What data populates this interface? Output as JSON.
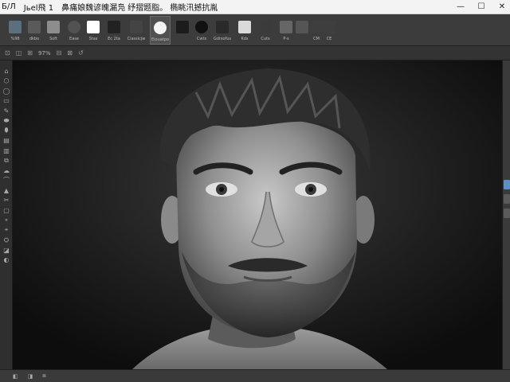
{
  "window": {
    "title_app": "Б/Л",
    "title_doc": "Jьel飛 1",
    "title_text": "鼻痛娘魏谚魄漏凫 纾摺题脂。 椭眺汛撼抗胤",
    "controls": [
      "—",
      "☐",
      "✕"
    ]
  },
  "presets": [
    {
      "label": "%98",
      "color": "#5b6f7e",
      "icon": "pointer-icon"
    },
    {
      "label": "dkbo",
      "color": "#5a5a5a",
      "icon": "brush-icon"
    },
    {
      "label": "Soft",
      "color": "#8d8d8d",
      "icon": "soft-brush-icon"
    },
    {
      "label": "Ease",
      "color": "#525252",
      "icon": "round-brush-icon"
    },
    {
      "label": "Stas",
      "color": "#ffffff",
      "icon": "square-brush-icon"
    },
    {
      "label": "Ec 2ta",
      "color": "#222222",
      "icon": "half-brush-icon"
    },
    {
      "label": "Ciassicjw",
      "color": "#444444",
      "icon": "gradient-brush-icon"
    },
    {
      "label": "Eiouatpo",
      "color": "#f4f4f4",
      "icon": "circle-brush-icon"
    },
    {
      "label": "",
      "color": "#1c1c1c",
      "icon": "ink-brush-icon"
    },
    {
      "label": "Cwts",
      "color": "#111111",
      "icon": "black-circle-icon"
    },
    {
      "label": "Gdrsofus",
      "color": "#2a2a2a",
      "icon": "splat-brush-icon"
    },
    {
      "label": "Kds",
      "color": "#dadada",
      "icon": "eraser-brush-icon"
    },
    {
      "label": "Cuts",
      "color": "#3b3b3b",
      "icon": "chalk-brush-icon"
    },
    {
      "label": "P-s",
      "color": "#666666",
      "icon": "pen-icon"
    },
    {
      "label": "",
      "color": "#555555",
      "icon": "tool-a-icon"
    },
    {
      "label": "CM",
      "color": "#3e3e3e",
      "icon": "tool-b-icon"
    },
    {
      "label": "CE",
      "color": "#3e3e3e",
      "icon": "tool-c-icon"
    }
  ],
  "subbar": {
    "items": [
      "⊡",
      "◫",
      "⊞",
      "⊟",
      "⊠",
      "↺"
    ],
    "zoom": "97%"
  },
  "tools": [
    "⌂",
    "⬡",
    "◯",
    "▭",
    "✎",
    "⬬",
    "⬮",
    "▤",
    "▥",
    "⧉",
    "☁",
    "⌒",
    "▲",
    "✂",
    "▢",
    "⚬",
    "⌖",
    "⛭",
    "◪",
    "◐"
  ],
  "statusbar": {
    "items": [
      "◧",
      "◨",
      "⧈"
    ]
  },
  "accent": "#5a8fc4"
}
